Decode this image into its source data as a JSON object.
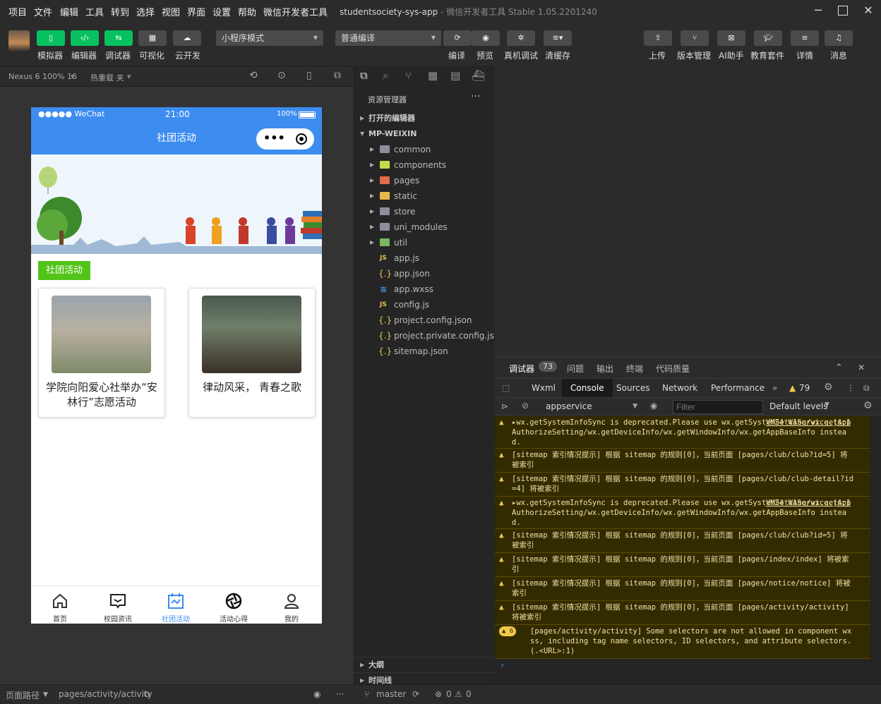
{
  "menu": [
    "项目",
    "文件",
    "编辑",
    "工具",
    "转到",
    "选择",
    "视图",
    "界面",
    "设置",
    "帮助",
    "微信开发者工具"
  ],
  "window": {
    "title": "studentsociety-sys-app",
    "subtitle": "- 微信开发者工具 Stable 1.05.2201240"
  },
  "toolbar": {
    "left": [
      {
        "icon": "phone-icon",
        "label": "模拟器"
      },
      {
        "icon": "code-icon",
        "label": "编辑器"
      },
      {
        "icon": "debug-icon",
        "label": "调试器"
      },
      {
        "icon": "visual-icon",
        "label": "可视化"
      },
      {
        "icon": "cloud-icon",
        "label": "云开发"
      }
    ],
    "mode_select": "小程序模式",
    "compile_select": "普通编译",
    "mid": [
      {
        "icon": "refresh-icon",
        "label": "编译"
      },
      {
        "icon": "eye-icon",
        "label": "预览"
      },
      {
        "icon": "bug-icon",
        "label": "真机调试"
      },
      {
        "icon": "layers-icon",
        "label": "清缓存"
      }
    ],
    "right": [
      {
        "icon": "upload-icon",
        "label": "上传"
      },
      {
        "icon": "branch-icon",
        "label": "版本管理"
      },
      {
        "icon": "ai-icon",
        "label": "AI助手"
      },
      {
        "icon": "graduation-icon",
        "label": "教育套件"
      },
      {
        "icon": "menu-icon",
        "label": "详情"
      },
      {
        "icon": "bell-icon",
        "label": "消息"
      }
    ]
  },
  "simbar": {
    "device": "Nexus 6 100% 16",
    "hotreload": "热重载 关"
  },
  "phone": {
    "status": {
      "carrier": "●●●●● WeChat",
      "time": "21:00",
      "battery": "100%"
    },
    "nav_title": "社团活动",
    "tag": "社团活动",
    "cards": [
      {
        "title": "学院向阳爱心社举办“安林行”志愿活动"
      },
      {
        "title": "律动风采， 青春之歌"
      }
    ],
    "tabs": [
      {
        "label": "首页",
        "icon": "home-icon"
      },
      {
        "label": "校园资讯",
        "icon": "message-icon"
      },
      {
        "label": "社团活动",
        "icon": "calendar-icon",
        "active": true
      },
      {
        "label": "活动心得",
        "icon": "aperture-icon"
      },
      {
        "label": "我的",
        "icon": "user-icon"
      }
    ]
  },
  "explorer": {
    "title": "资源管理器",
    "open_editors": "打开的编辑器",
    "root": "MP-WEIXIN",
    "folders": [
      {
        "name": "common",
        "color": "#8a8f99"
      },
      {
        "name": "components",
        "color": "#c5d94a"
      },
      {
        "name": "pages",
        "color": "#e06c4b"
      },
      {
        "name": "static",
        "color": "#e8b84a"
      },
      {
        "name": "store",
        "color": "#8a8f99"
      },
      {
        "name": "uni_modules",
        "color": "#8a8f99"
      },
      {
        "name": "util",
        "color": "#7bb661"
      }
    ],
    "files": [
      {
        "name": "app.js",
        "icon": "js"
      },
      {
        "name": "app.json",
        "icon": "json"
      },
      {
        "name": "app.wxss",
        "icon": "css"
      },
      {
        "name": "config.js",
        "icon": "js"
      },
      {
        "name": "project.config.json",
        "icon": "json"
      },
      {
        "name": "project.private.config.js...",
        "icon": "json"
      },
      {
        "name": "sitemap.json",
        "icon": "json"
      }
    ],
    "outline": "大纲",
    "timeline": "时间线"
  },
  "devtools": {
    "tabs": [
      "调试器",
      "问题",
      "输出",
      "终端",
      "代码质量"
    ],
    "badge": "73",
    "panels": [
      "Wxml",
      "Console",
      "Sources",
      "Network",
      "Performance"
    ],
    "warn_count": "79",
    "context": "appservice",
    "filter_placeholder": "Filter",
    "levels": "Default levels",
    "messages": [
      {
        "text": "▸wx.getSystemInfoSync is deprecated.Please use wx.getSystemSetting/wx.getAppAuthorizeSetting/wx.getDeviceInfo/wx.getWindowInfo/wx.getAppBaseInfo instead.",
        "link": "VM24 WAService.js:1"
      },
      {
        "text": "[sitemap 索引情况提示] 根据 sitemap 的规则[0]，当前页面 [pages/club/club?id=5] 将被索引",
        "link": ""
      },
      {
        "text": "[sitemap 索引情况提示] 根据 sitemap 的规则[0]，当前页面 [pages/club/club-detail?id=4] 将被索引",
        "link": ""
      },
      {
        "text": "▸wx.getSystemInfoSync is deprecated.Please use wx.getSystemSetting/wx.getAppAuthorizeSetting/wx.getDeviceInfo/wx.getWindowInfo/wx.getAppBaseInfo instead.",
        "link": "VM24 WAService.js:1"
      },
      {
        "text": "[sitemap 索引情况提示] 根据 sitemap 的规则[0]，当前页面 [pages/club/club?id=5] 将被索引",
        "link": ""
      },
      {
        "text": "[sitemap 索引情况提示] 根据 sitemap 的规则[0]，当前页面 [pages/index/index] 将被索引",
        "link": ""
      },
      {
        "text": "[sitemap 索引情况提示] 根据 sitemap 的规则[0]，当前页面 [pages/notice/notice] 将被索引",
        "link": ""
      },
      {
        "text": "[sitemap 索引情况提示] 根据 sitemap 的规则[0]，当前页面 [pages/activity/activity] 将被索引",
        "link": ""
      },
      {
        "text": "[pages/activity/activity] Some selectors are not allowed in component wxss, including tag name selectors, ID selectors, and attribute selectors.(.<URL>:1)",
        "link": "",
        "badge": "6"
      }
    ],
    "prompt": "›"
  },
  "footer": {
    "path_label": "页面路径",
    "path": "pages/activity/activity",
    "branch": "master",
    "errors": "0",
    "warnings": "0"
  }
}
